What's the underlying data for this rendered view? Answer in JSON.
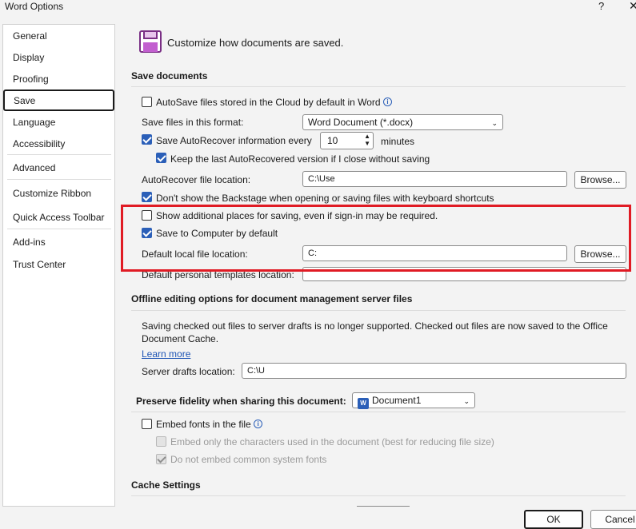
{
  "window": {
    "title": "Word Options",
    "help": "?",
    "close": "✕"
  },
  "sidebar": {
    "items": [
      {
        "label": "General"
      },
      {
        "label": "Display"
      },
      {
        "label": "Proofing"
      },
      {
        "label": "Save"
      },
      {
        "label": "Language"
      },
      {
        "label": "Accessibility"
      },
      {
        "label": "Advanced"
      },
      {
        "label": "Customize Ribbon"
      },
      {
        "label": "Quick Access Toolbar"
      },
      {
        "label": "Add-ins"
      },
      {
        "label": "Trust Center"
      }
    ],
    "selected": "Save"
  },
  "header": {
    "text": "Customize how documents are saved."
  },
  "save_documents": {
    "heading": "Save documents",
    "autosave_label": "AutoSave files stored in the Cloud by default in Word",
    "format_label": "Save files in this format:",
    "format_value": "Word Document (*.docx)",
    "autorecover_label": "Save AutoRecover information every",
    "autorecover_value": "10",
    "minutes_label": "minutes",
    "keep_last_label": "Keep the last AutoRecovered version if I close without saving",
    "autorecover_location_label": "AutoRecover file location:",
    "autorecover_location_value": "C:\\Use",
    "browse_label": "Browse...",
    "dont_show_backstage_label": "Don't show the Backstage when opening or saving files with keyboard shortcuts",
    "additional_places_label": "Show additional places for saving, even if sign-in may be required.",
    "save_to_computer_label": "Save to Computer by default",
    "default_local_label": "Default local file location:",
    "default_local_value": "C:",
    "default_templates_label": "Default personal templates location:",
    "default_templates_value": ""
  },
  "offline": {
    "heading": "Offline editing options for document management server files",
    "description": "Saving checked out files to server drafts is no longer supported. Checked out files are now saved to the Office",
    "description2": "Document Cache.",
    "learn_more": "Learn more",
    "server_drafts_label": "Server drafts location:",
    "server_drafts_value": "C:\\U"
  },
  "fidelity": {
    "heading": "Preserve fidelity when sharing this document:",
    "document_value": "Document1",
    "embed_fonts_label": "Embed fonts in the file",
    "embed_chars_label": "Embed only the characters used in the document (best for reducing file size)",
    "no_common_label": "Do not embed common system fonts"
  },
  "cache": {
    "heading": "Cache Settings"
  },
  "footer": {
    "ok": "OK",
    "cancel": "Cancel"
  },
  "colors": {
    "accent": "#2b5fb8",
    "highlight": "#e01b24",
    "link": "#1f55b5"
  }
}
